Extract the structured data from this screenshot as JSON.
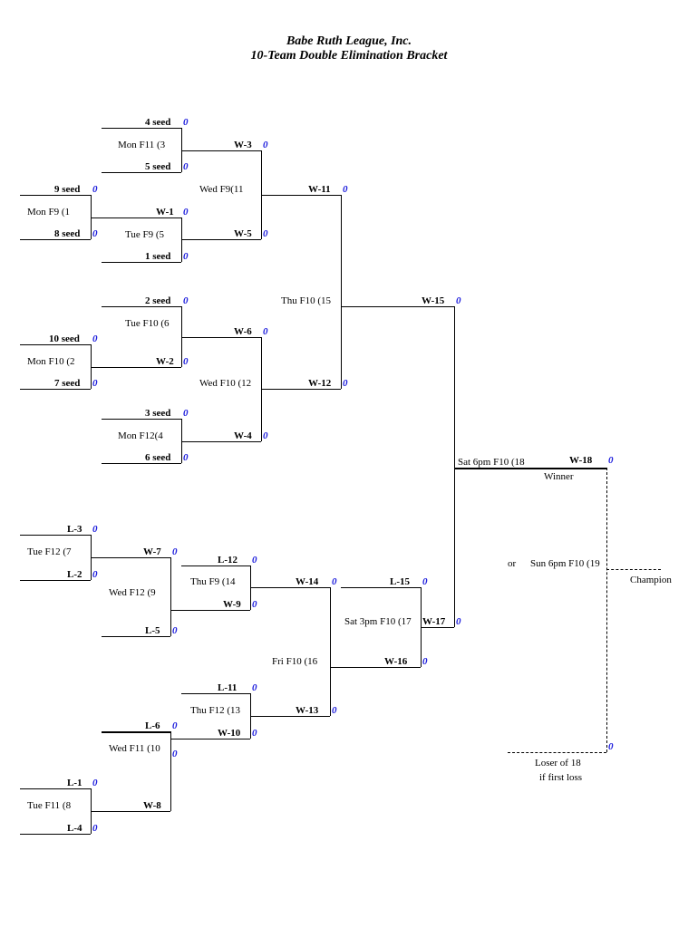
{
  "title": "Babe Ruth League, Inc.",
  "subtitle": "10-Team Double Elimination Bracket",
  "zero": "0",
  "seeds": {
    "s4": "4 seed",
    "s5": "5 seed",
    "s9": "9 seed",
    "s8": "8 seed",
    "s1": "1 seed",
    "s2": "2 seed",
    "s10": "10 seed",
    "s7": "7 seed",
    "s3": "3 seed",
    "s6": "6 seed"
  },
  "games": {
    "g1": "Mon F9 (1",
    "g2": "Mon F10 (2",
    "g3": "Mon F11 (3",
    "g4": "Mon F12(4",
    "g5": "Tue F9 (5",
    "g6": "Tue F10 (6",
    "g7": "Tue F12 (7",
    "g8": "Tue F11 (8",
    "g9": "Wed F12 (9",
    "g10": "Wed F11 (10",
    "g11": "Wed F9(11",
    "g12": "Wed F10 (12",
    "g13": "Thu F12 (13",
    "g14": "Thu F9 (14",
    "g15": "Thu F10 (15",
    "g16": "Fri F10 (16",
    "g17": "Sat 3pm F10 (17",
    "g18": "Sat 6pm F10 (18",
    "g19": "Sun 6pm F10 (19"
  },
  "adv": {
    "w1": "W-1",
    "w2": "W-2",
    "w3": "W-3",
    "w4": "W-4",
    "w5": "W-5",
    "w6": "W-6",
    "w7": "W-7",
    "w8": "W-8",
    "w9": "W-9",
    "w10": "W-10",
    "w11": "W-11",
    "w12": "W-12",
    "w13": "W-13",
    "w14": "W-14",
    "w15": "W-15",
    "w16": "W-16",
    "w17": "W-17",
    "w18": "W-18",
    "l1": "L-1",
    "l2": "L-2",
    "l3": "L-3",
    "l4": "L-4",
    "l5": "L-5",
    "l6": "L-6",
    "l11": "L-11",
    "l12": "L-12",
    "l15": "L-15"
  },
  "text": {
    "winner": "Winner",
    "or": "or",
    "champion": "Champion",
    "loser18": "Loser of 18",
    "iffirst": "if first loss"
  }
}
